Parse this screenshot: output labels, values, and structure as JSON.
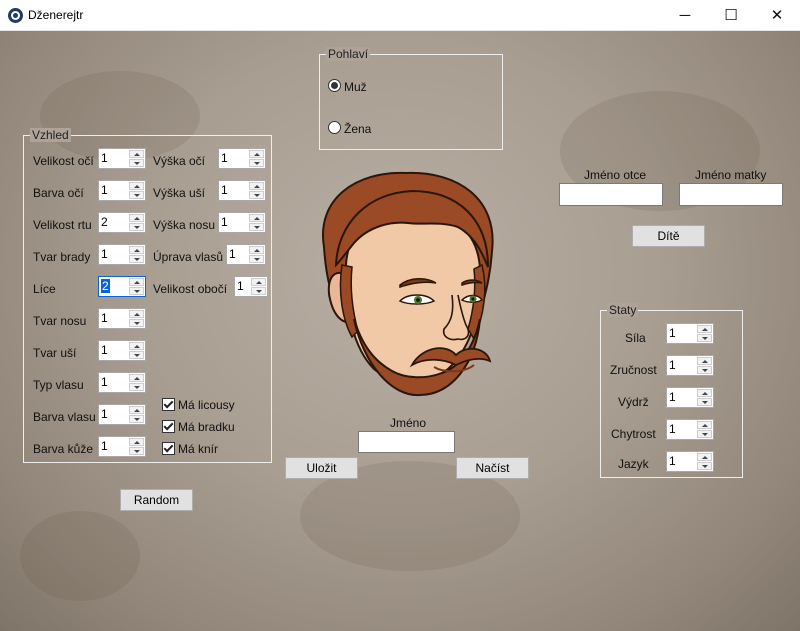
{
  "window": {
    "title": "Dženerejtr"
  },
  "gender": {
    "legend": "Pohlaví",
    "options": [
      "Muž",
      "Žena"
    ],
    "selected": "Muž"
  },
  "looks": {
    "legend": "Vzhled",
    "left_fields": [
      {
        "label": "Velikost očí",
        "value": "1"
      },
      {
        "label": "Barva očí",
        "value": "1"
      },
      {
        "label": "Velikost rtu",
        "value": "2"
      },
      {
        "label": "Tvar brady",
        "value": "1"
      },
      {
        "label": "Líce",
        "value": "2"
      },
      {
        "label": "Tvar nosu",
        "value": "1"
      },
      {
        "label": "Tvar uší",
        "value": "1"
      },
      {
        "label": "Typ vlasu",
        "value": "1"
      },
      {
        "label": "Barva vlasu",
        "value": "1"
      },
      {
        "label": "Barva kůže",
        "value": "1"
      }
    ],
    "right_fields": [
      {
        "label": "Výška očí",
        "value": "1"
      },
      {
        "label": "Výška uší",
        "value": "1"
      },
      {
        "label": "Výška nosu",
        "value": "1"
      },
      {
        "label": "Úprava vlasů",
        "value": "1"
      },
      {
        "label": "Velikost obočí",
        "value": "1"
      }
    ],
    "checkboxes": [
      {
        "label": "Má licousy",
        "checked": true
      },
      {
        "label": "Má bradku",
        "checked": true
      },
      {
        "label": "Má knír",
        "checked": true
      }
    ]
  },
  "random_button": "Random",
  "name": {
    "label": "Jméno",
    "value": ""
  },
  "save_button": "Uložit",
  "load_button": "Načíst",
  "parents": {
    "father_label": "Jméno otce",
    "mother_label": "Jméno matky",
    "father_value": "",
    "mother_value": "",
    "child_button": "Dítě"
  },
  "stats": {
    "legend": "Staty",
    "fields": [
      {
        "label": "Síla",
        "value": "1"
      },
      {
        "label": "Zručnost",
        "value": "1"
      },
      {
        "label": "Výdrž",
        "value": "1"
      },
      {
        "label": "Chytrost",
        "value": "1"
      },
      {
        "label": "Jazyk",
        "value": "1"
      }
    ]
  },
  "colors": {
    "hair": "#9a4a24",
    "skin": "#f1c9a6",
    "eye_iris": "#4f7a2c",
    "background": "#a99e92"
  }
}
